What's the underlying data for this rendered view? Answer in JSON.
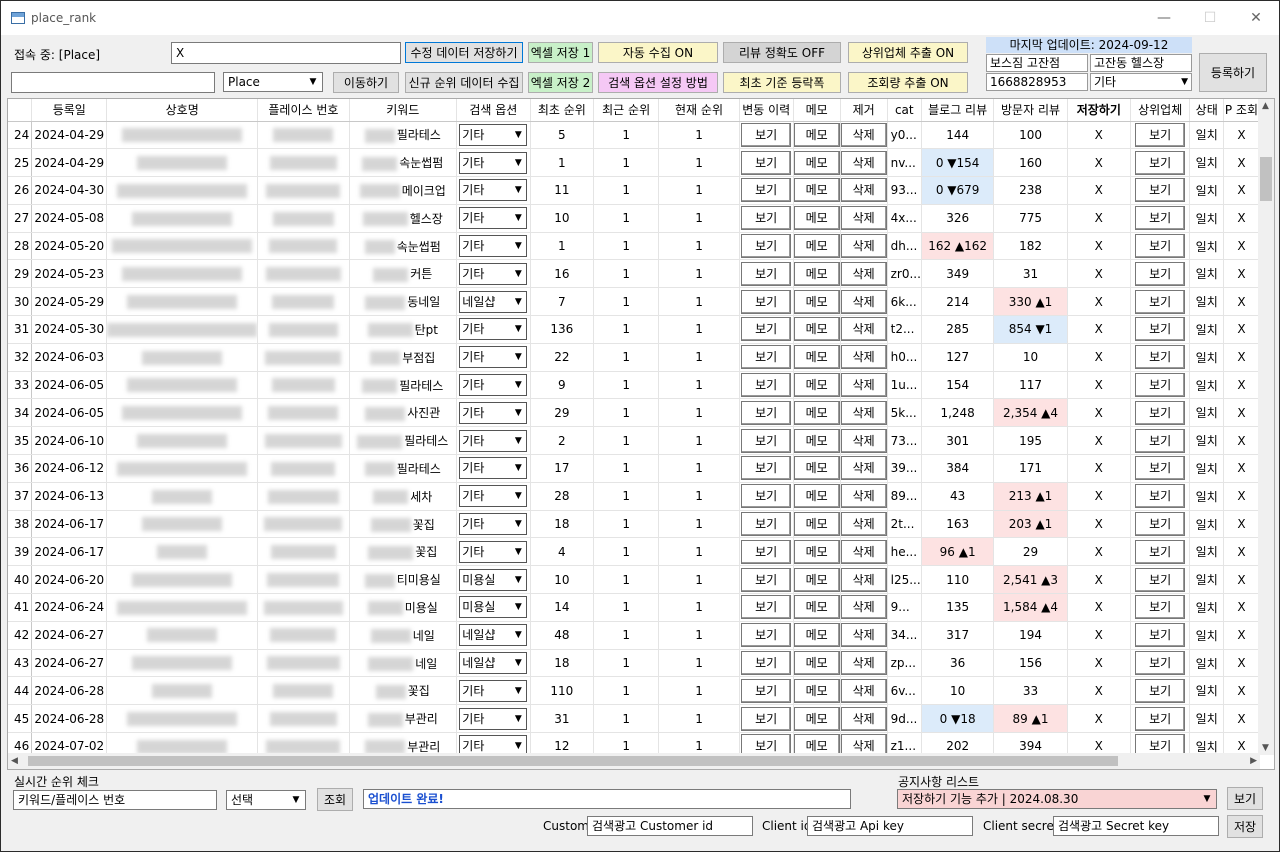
{
  "window": {
    "title": "place_rank",
    "minimize": "—",
    "maximize": "☐",
    "close": "✕"
  },
  "top": {
    "connected_label": "접속 중: [Place]",
    "input1_value": "X",
    "input2_value": "",
    "type_select": "Place",
    "buttons": {
      "save_modified": "수정 데이터 저장하기",
      "excel_save_1": "엑셀 저장 1",
      "auto_collect": "자동 수집 ON",
      "review_accuracy": "리뷰 정확도 OFF",
      "top_extract": "상위업체 추출 ON",
      "move": "이동하기",
      "collect_new": "신규 순위 데이터 수집",
      "excel_save_2": "엑셀 저장 2",
      "search_option_help": "검색 옵션 설정 방법",
      "initial_registry": "최초 기준 등락폭",
      "views_extract": "조회량 추출 ON",
      "register": "등록하기"
    },
    "last_update_label": "마지막 업데이트: 2024-09-12",
    "reg_name": "보스짐 고잔점",
    "reg_keyword": "고잔동 헬스장",
    "reg_place_no": "1668828953",
    "reg_option": "기타"
  },
  "table": {
    "headers": [
      "",
      "등록일",
      "상호명",
      "플레이스 번호",
      "키워드",
      "검색 옵션",
      "최초 순위",
      "최근 순위",
      "현재 순위",
      "변동 이력",
      "메모",
      "제거",
      "cat",
      "블로그 리뷰",
      "방문자 리뷰",
      "저장하기",
      "상위업체",
      "상태",
      "P 조회"
    ],
    "action_labels": {
      "view": "보기",
      "memo": "메모",
      "delete": "삭제"
    },
    "rows": [
      {
        "no": "24",
        "date": "2024-04-29",
        "kw": "필라테스",
        "opt": "기타",
        "first": "5",
        "recent": "1",
        "current": "1",
        "cat": "y0...",
        "blog": "144",
        "blog_c": "",
        "visit": "100",
        "visit_c": "",
        "save": "X",
        "state": "일치",
        "p": "X"
      },
      {
        "no": "25",
        "date": "2024-04-29",
        "kw": "속눈썹펌",
        "opt": "기타",
        "first": "1",
        "recent": "1",
        "current": "1",
        "cat": "nv...",
        "blog": "0 ▼154",
        "blog_c": "blue",
        "visit": "160",
        "visit_c": "",
        "save": "X",
        "state": "일치",
        "p": "X"
      },
      {
        "no": "26",
        "date": "2024-04-30",
        "kw": "메이크업",
        "opt": "기타",
        "first": "11",
        "recent": "1",
        "current": "1",
        "cat": "93...",
        "blog": "0 ▼679",
        "blog_c": "blue",
        "visit": "238",
        "visit_c": "",
        "save": "X",
        "state": "일치",
        "p": "X"
      },
      {
        "no": "27",
        "date": "2024-05-08",
        "kw": "헬스장",
        "opt": "기타",
        "first": "10",
        "recent": "1",
        "current": "1",
        "cat": "4x...",
        "blog": "326",
        "blog_c": "",
        "visit": "775",
        "visit_c": "",
        "save": "X",
        "state": "일치",
        "p": "X"
      },
      {
        "no": "28",
        "date": "2024-05-20",
        "kw": "속눈썹펌",
        "opt": "기타",
        "first": "1",
        "recent": "1",
        "current": "1",
        "cat": "dh...",
        "blog": "162 ▲162",
        "blog_c": "pink",
        "visit": "182",
        "visit_c": "",
        "save": "X",
        "state": "일치",
        "p": "X"
      },
      {
        "no": "29",
        "date": "2024-05-23",
        "kw": "커튼",
        "opt": "기타",
        "first": "16",
        "recent": "1",
        "current": "1",
        "cat": "zr0...",
        "blog": "349",
        "blog_c": "",
        "visit": "31",
        "visit_c": "",
        "save": "X",
        "state": "일치",
        "p": "X"
      },
      {
        "no": "30",
        "date": "2024-05-29",
        "kw": "동네일",
        "opt": "네일샵",
        "first": "7",
        "recent": "1",
        "current": "1",
        "cat": "6k...",
        "blog": "214",
        "blog_c": "",
        "visit": "330 ▲1",
        "visit_c": "pink",
        "save": "X",
        "state": "일치",
        "p": "X"
      },
      {
        "no": "31",
        "date": "2024-05-30",
        "kw": "탄pt",
        "opt": "기타",
        "first": "136",
        "recent": "1",
        "current": "1",
        "cat": "t2...",
        "blog": "285",
        "blog_c": "",
        "visit": "854 ▼1",
        "visit_c": "blue",
        "save": "X",
        "state": "일치",
        "p": "X"
      },
      {
        "no": "32",
        "date": "2024-06-03",
        "kw": "부점집",
        "opt": "기타",
        "first": "22",
        "recent": "1",
        "current": "1",
        "cat": "h0...",
        "blog": "127",
        "blog_c": "",
        "visit": "10",
        "visit_c": "",
        "save": "X",
        "state": "일치",
        "p": "X"
      },
      {
        "no": "33",
        "date": "2024-06-05",
        "kw": "필라테스",
        "opt": "기타",
        "first": "9",
        "recent": "1",
        "current": "1",
        "cat": "1u...",
        "blog": "154",
        "blog_c": "",
        "visit": "117",
        "visit_c": "",
        "save": "X",
        "state": "일치",
        "p": "X"
      },
      {
        "no": "34",
        "date": "2024-06-05",
        "kw": "사진관",
        "opt": "기타",
        "first": "29",
        "recent": "1",
        "current": "1",
        "cat": "5k...",
        "blog": "1,248",
        "blog_c": "",
        "visit": "2,354 ▲4",
        "visit_c": "pink",
        "save": "X",
        "state": "일치",
        "p": "X"
      },
      {
        "no": "35",
        "date": "2024-06-10",
        "kw": "필라테스",
        "opt": "기타",
        "first": "2",
        "recent": "1",
        "current": "1",
        "cat": "73...",
        "blog": "301",
        "blog_c": "",
        "visit": "195",
        "visit_c": "",
        "save": "X",
        "state": "일치",
        "p": "X"
      },
      {
        "no": "36",
        "date": "2024-06-12",
        "kw": "필라테스",
        "opt": "기타",
        "first": "17",
        "recent": "1",
        "current": "1",
        "cat": "39...",
        "blog": "384",
        "blog_c": "",
        "visit": "171",
        "visit_c": "",
        "save": "X",
        "state": "일치",
        "p": "X"
      },
      {
        "no": "37",
        "date": "2024-06-13",
        "kw": "세차",
        "opt": "기타",
        "first": "28",
        "recent": "1",
        "current": "1",
        "cat": "89...",
        "blog": "43",
        "blog_c": "",
        "visit": "213 ▲1",
        "visit_c": "pink",
        "save": "X",
        "state": "일치",
        "p": "X"
      },
      {
        "no": "38",
        "date": "2024-06-17",
        "kw": "꽃집",
        "opt": "기타",
        "first": "18",
        "recent": "1",
        "current": "1",
        "cat": "2t...",
        "blog": "163",
        "blog_c": "",
        "visit": "203 ▲1",
        "visit_c": "pink",
        "save": "X",
        "state": "일치",
        "p": "X"
      },
      {
        "no": "39",
        "date": "2024-06-17",
        "kw": "꽃집",
        "opt": "기타",
        "first": "4",
        "recent": "1",
        "current": "1",
        "cat": "he...",
        "blog": "96 ▲1",
        "blog_c": "pink",
        "visit": "29",
        "visit_c": "",
        "save": "X",
        "state": "일치",
        "p": "X"
      },
      {
        "no": "40",
        "date": "2024-06-20",
        "kw": "티미용실",
        "opt": "미용실",
        "first": "10",
        "recent": "1",
        "current": "1",
        "cat": "l25...",
        "blog": "110",
        "blog_c": "",
        "visit": "2,541 ▲3",
        "visit_c": "pink",
        "save": "X",
        "state": "일치",
        "p": "X"
      },
      {
        "no": "41",
        "date": "2024-06-24",
        "kw": "미용실",
        "opt": "미용실",
        "first": "14",
        "recent": "1",
        "current": "1",
        "cat": "9...",
        "blog": "135",
        "blog_c": "",
        "visit": "1,584 ▲4",
        "visit_c": "pink",
        "save": "X",
        "state": "일치",
        "p": "X"
      },
      {
        "no": "42",
        "date": "2024-06-27",
        "kw": "네일",
        "opt": "네일샵",
        "first": "48",
        "recent": "1",
        "current": "1",
        "cat": "34...",
        "blog": "317",
        "blog_c": "",
        "visit": "194",
        "visit_c": "",
        "save": "X",
        "state": "일치",
        "p": "X"
      },
      {
        "no": "43",
        "date": "2024-06-27",
        "kw": "네일",
        "opt": "네일샵",
        "first": "18",
        "recent": "1",
        "current": "1",
        "cat": "zp...",
        "blog": "36",
        "blog_c": "",
        "visit": "156",
        "visit_c": "",
        "save": "X",
        "state": "일치",
        "p": "X"
      },
      {
        "no": "44",
        "date": "2024-06-28",
        "kw": "꽃집",
        "opt": "기타",
        "first": "110",
        "recent": "1",
        "current": "1",
        "cat": "6v...",
        "blog": "10",
        "blog_c": "",
        "visit": "33",
        "visit_c": "",
        "save": "X",
        "state": "일치",
        "p": "X"
      },
      {
        "no": "45",
        "date": "2024-06-28",
        "kw": "부관리",
        "opt": "기타",
        "first": "31",
        "recent": "1",
        "current": "1",
        "cat": "9d...",
        "blog": "0 ▼18",
        "blog_c": "blue",
        "visit": "89 ▲1",
        "visit_c": "pink",
        "save": "X",
        "state": "일치",
        "p": "X"
      },
      {
        "no": "46",
        "date": "2024-07-02",
        "kw": "부관리",
        "opt": "기타",
        "first": "12",
        "recent": "1",
        "current": "1",
        "cat": "z1...",
        "blog": "202",
        "blog_c": "",
        "visit": "394",
        "visit_c": "",
        "save": "X",
        "state": "일치",
        "p": "X"
      }
    ]
  },
  "bottom": {
    "realtime_label": "실시간 순위 체크",
    "realtime_input_placeholder": "키워드/플레이스 번호",
    "select_label": "선택",
    "lookup_button": "조회",
    "status_text": "업데이트 완료!",
    "notice_label": "공지사항 리스트",
    "notice_value": "저장하기 기능 추가 | 2024.08.30",
    "view_button": "보기",
    "custom_label": "Custom",
    "custom_value": "검색광고 Customer id",
    "client_id_label": "Client id",
    "client_id_value": "검색광고 Api key",
    "client_secret_label": "Client secret",
    "client_secret_value": "검색광고 Secret key",
    "save_button": "저장"
  },
  "colors": {
    "pink_highlight": "#fde2e2",
    "blue_highlight": "#dcebfa",
    "status_blue": "#1a4fd0"
  }
}
